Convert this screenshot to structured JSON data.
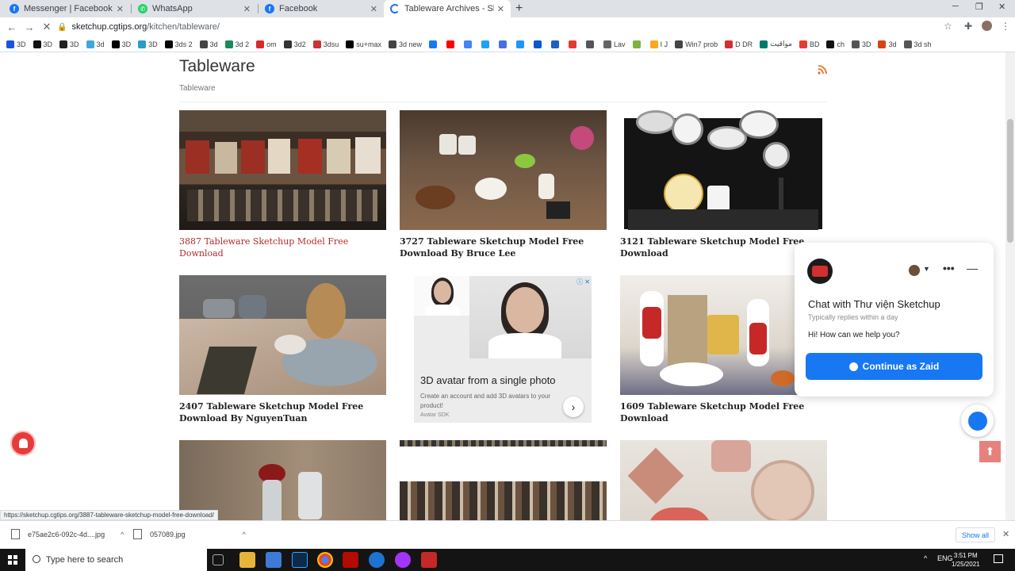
{
  "browser": {
    "tabs": [
      {
        "title": "Messenger | Facebook",
        "icon": "facebook-icon",
        "color": "#1877f2"
      },
      {
        "title": "WhatsApp",
        "icon": "whatsapp-icon",
        "color": "#25d366"
      },
      {
        "title": "Facebook",
        "icon": "facebook-icon",
        "color": "#1877f2"
      },
      {
        "title": "Tableware Archives - Sketchup -",
        "icon": "loading-icon",
        "color": "#1a73e8"
      }
    ],
    "url_host": "sketchup.cgtips.org",
    "url_path": "/kitchen/tableware/"
  },
  "bookmarks": [
    {
      "label": "3D",
      "color": "#1a56db"
    },
    {
      "label": "3D",
      "color": "#111"
    },
    {
      "label": "3D",
      "color": "#222"
    },
    {
      "label": "3d",
      "color": "#3fa9d8"
    },
    {
      "label": "3D",
      "color": "#000"
    },
    {
      "label": "3D",
      "color": "#2b9bc7"
    },
    {
      "label": "3ds 2",
      "color": "#000"
    },
    {
      "label": "3d",
      "color": "#444"
    },
    {
      "label": "3d 2",
      "color": "#1a8a5a"
    },
    {
      "label": "om",
      "color": "#d62b2b"
    },
    {
      "label": "3d2",
      "color": "#333"
    },
    {
      "label": "3dsu",
      "color": "#c33"
    },
    {
      "label": "su+max",
      "color": "#000"
    },
    {
      "label": "3d new",
      "color": "#444"
    },
    {
      "label": "",
      "color": "#1877f2"
    },
    {
      "label": "",
      "color": "#ff0000"
    },
    {
      "label": "",
      "color": "#4285f4"
    },
    {
      "label": "",
      "color": "#1da1f2"
    },
    {
      "label": "",
      "color": "#4a6ee0"
    },
    {
      "label": "",
      "color": "#2196f3"
    },
    {
      "label": "",
      "color": "#0b57d0"
    },
    {
      "label": "",
      "color": "#1f5fbf"
    },
    {
      "label": "",
      "color": "#e53935"
    },
    {
      "label": "",
      "color": "#555"
    },
    {
      "label": "Lav",
      "color": "#666"
    },
    {
      "label": "",
      "color": "#7cb342"
    },
    {
      "label": "I J",
      "color": "#f9a825"
    },
    {
      "label": "Win7 prob",
      "color": "#444"
    },
    {
      "label": "D DR",
      "color": "#d32f2f"
    },
    {
      "label": "مواقيت",
      "color": "#00796b"
    },
    {
      "label": "BD",
      "color": "#e53935"
    },
    {
      "label": "ch",
      "color": "#111"
    },
    {
      "label": "3D",
      "color": "#555"
    },
    {
      "label": "3d",
      "color": "#d84315"
    },
    {
      "label": "3d sh",
      "color": "#555"
    }
  ],
  "page": {
    "title": "Tableware",
    "breadcrumb": "Tableware",
    "cards": [
      {
        "title": "3887 Tableware Sketchup Model Free Download",
        "active": true
      },
      {
        "title": "3727 Tableware Sketchup Model Free Download By Bruce Lee"
      },
      {
        "title": "3121 Tableware Sketchup Model Free Download"
      },
      {
        "title": "2407 Tableware Sketchup Model Free Download By NguyenTuan"
      },
      {
        "title": "1609 Tableware Sketchup Model Free Download"
      }
    ],
    "ad": {
      "title": "3D avatar from a single photo",
      "text": "Create an account and add 3D avatars to your product!",
      "source": "Avatar SDK",
      "badge": "ⓘ ✕"
    }
  },
  "chat": {
    "title": "Chat with Thư viện Sketchup",
    "subtitle": "Typically replies within a day",
    "greeting": "Hi! How can we help you?",
    "button": "Continue as Zaid"
  },
  "status_url": "https://sketchup.cgtips.org/3887-tableware-sketchup-model-free-download/",
  "downloads": {
    "items": [
      "e75ae2c6-092c-4d....jpg",
      "057089.jpg"
    ],
    "show_all": "Show all"
  },
  "taskbar": {
    "search_placeholder": "Type here to search",
    "lang": "ENG",
    "time": "3:51 PM",
    "date": "1/25/2021"
  }
}
